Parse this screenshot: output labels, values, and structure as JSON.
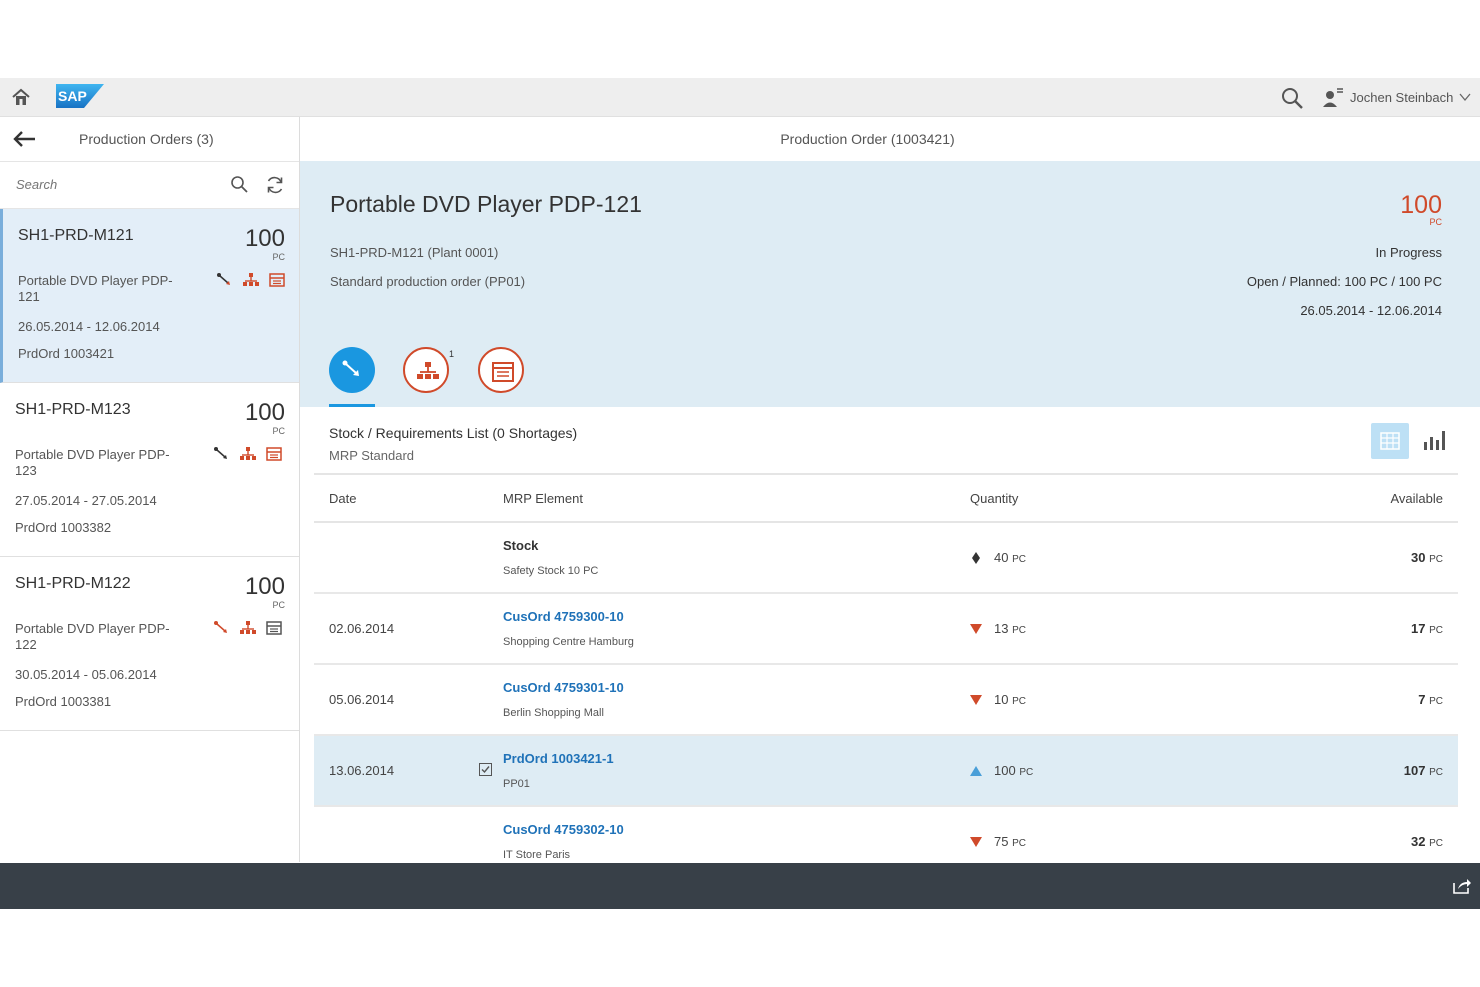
{
  "shell": {
    "user_name": "Jochen Steinbach",
    "logo_text": "SAP"
  },
  "master": {
    "title": "Production Orders (3)",
    "search_placeholder": "Search",
    "items": [
      {
        "id": "SH1-PRD-M121",
        "qty": "100",
        "unit": "PC",
        "desc": "Portable DVD Player PDP-121",
        "dates": "26.05.2014 - 12.06.2014",
        "order": "PrdOrd 1003421"
      },
      {
        "id": "SH1-PRD-M123",
        "qty": "100",
        "unit": "PC",
        "desc": "Portable DVD Player PDP-123",
        "dates": "27.05.2014 - 27.05.2014",
        "order": "PrdOrd 1003382"
      },
      {
        "id": "SH1-PRD-M122",
        "qty": "100",
        "unit": "PC",
        "desc": "Portable DVD Player PDP-122",
        "dates": "30.05.2014 - 05.06.2014",
        "order": "PrdOrd 1003381"
      }
    ]
  },
  "detail": {
    "header_title": "Production Order (1003421)",
    "object_title": "Portable DVD Player PDP-121",
    "plant": "SH1-PRD-M121 (Plant 0001)",
    "order_type": "Standard production order (PP01)",
    "qty": "100",
    "unit": "PC",
    "status": "In Progress",
    "open_planned": "Open / Planned: 100 PC / 100 PC",
    "dates": "26.05.2014 - 12.06.2014",
    "tab_badge": "1",
    "section_title": "Stock / Requirements List (0 Shortages)",
    "section_subtitle": "MRP Standard",
    "columns": {
      "date": "Date",
      "element": "MRP Element",
      "quantity": "Quantity",
      "available": "Available"
    },
    "rows": [
      {
        "date": "",
        "element": "Stock",
        "sub": "Safety Stock 10 PC",
        "qty": "40",
        "qty_unit": "PC",
        "avail": "30",
        "avail_unit": "PC"
      },
      {
        "date": "02.06.2014",
        "element": "CusOrd 4759300-10",
        "sub": "Shopping Centre Hamburg",
        "qty": "13",
        "qty_unit": "PC",
        "avail": "17",
        "avail_unit": "PC"
      },
      {
        "date": "05.06.2014",
        "element": "CusOrd 4759301-10",
        "sub": "Berlin Shopping Mall",
        "qty": "10",
        "qty_unit": "PC",
        "avail": "7",
        "avail_unit": "PC"
      },
      {
        "date": "13.06.2014",
        "element": "PrdOrd 1003421-1",
        "sub": "PP01",
        "qty": "100",
        "qty_unit": "PC",
        "avail": "107",
        "avail_unit": "PC"
      },
      {
        "date": "",
        "element": "CusOrd 4759302-10",
        "sub": "IT Store Paris",
        "qty": "75",
        "qty_unit": "PC",
        "avail": "32",
        "avail_unit": "PC"
      }
    ]
  },
  "colors": {
    "accent_blue": "#1a97e0",
    "alert_red": "#d04a2a",
    "header_bg": "#deecf4",
    "footer_bg": "#384048"
  }
}
